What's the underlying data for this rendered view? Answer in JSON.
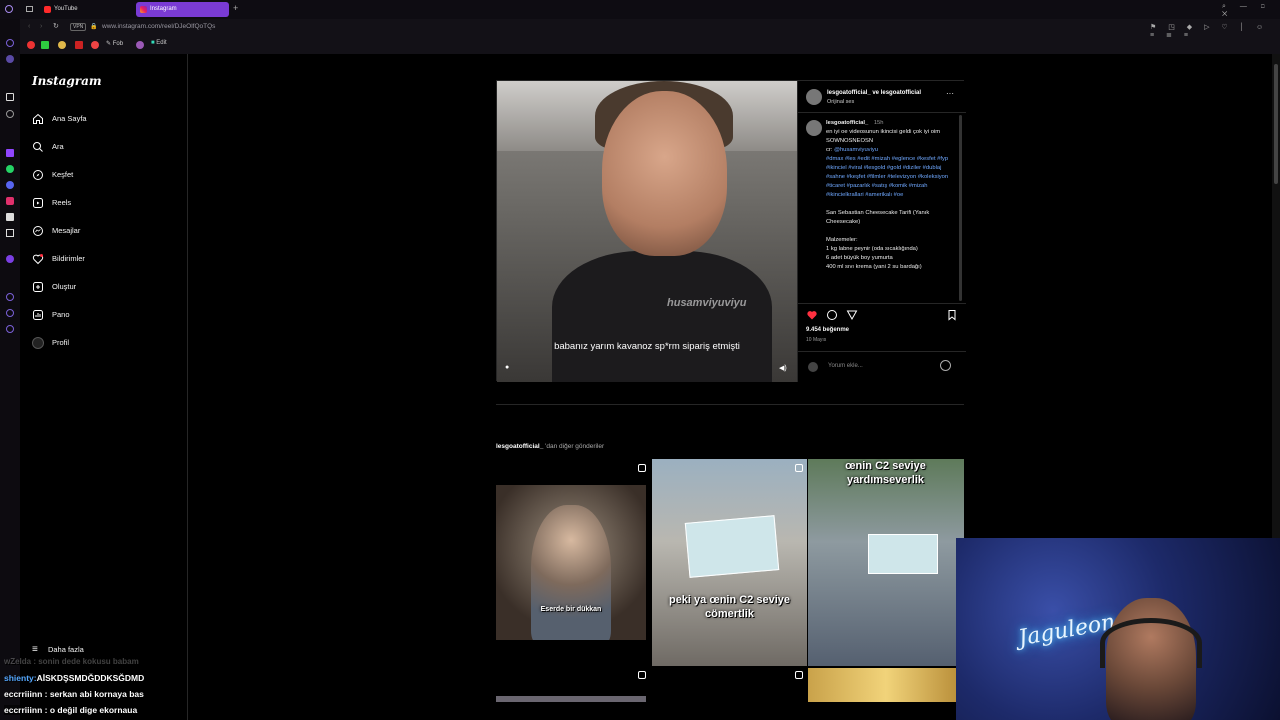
{
  "browser": {
    "tabs": [
      {
        "label": "YouTube"
      },
      {
        "label": "Instagram"
      }
    ],
    "url": "www.instagram.com/reel/DJeOlfQoTQs",
    "vpn_badge": "VPN",
    "bookmarks": [
      {
        "label": "Fob"
      },
      {
        "label": "Edit"
      }
    ]
  },
  "sidebar": {
    "logo": "Instagram",
    "items": [
      {
        "label": "Ana Sayfa",
        "icon": "home-icon"
      },
      {
        "label": "Ara",
        "icon": "search-icon"
      },
      {
        "label": "Keşfet",
        "icon": "compass-icon"
      },
      {
        "label": "Reels",
        "icon": "reels-icon"
      },
      {
        "label": "Mesajlar",
        "icon": "messenger-icon"
      },
      {
        "label": "Bildirimler",
        "icon": "heart-icon"
      },
      {
        "label": "Oluştur",
        "icon": "plus-square-icon"
      },
      {
        "label": "Pano",
        "icon": "dashboard-icon"
      },
      {
        "label": "Profil",
        "icon": "avatar-icon"
      }
    ],
    "more": "Daha fazla"
  },
  "post": {
    "video_watermark": "husamviyuviyu",
    "subtitle": "babanız yarım kavanoz sp*rm sipariş etmişti",
    "header_user": "lesgoatofficial_ ve lesgoatofficial",
    "header_sub": "Orijinal ses",
    "caption_user": "lesgoatofficial_",
    "caption_time": "15h",
    "caption_text": "en iyi oe videosunun ikincisi geldi çok iyi oim SOWNOSNEOSN",
    "caption_cr": "cr:",
    "caption_mention": "@husamviyuviyu",
    "caption_tags": "#dmax #les #edit #mizah #eglence #kesfet #fyp #ikinciel #viral #lesgold #gold #diziler #dublaj #sahne #keşfet #filmler #televizyon #koleksiyon #ticaret #pazarlık #satış #komik #mizah #ikincielkrallari #amerikalı #oe",
    "recipe_title": "San Sebastian Cheesecake Tarifi (Yanık Cheesecake)",
    "recipe_head": "Malzemeler:",
    "recipe_items": [
      "1 kg labne peynir (oda sıcaklığında)",
      "6 adet büyük boy yumurta",
      "400 ml sıvı krema (yani 2 su bardağı)"
    ],
    "likes": "9.454 beğenme",
    "date": "10 Mayıs",
    "comment_placeholder": "Yorum ekle..."
  },
  "more_posts": {
    "user": "lesgoatofficial_",
    "suffix": " 'dan diğer gönderiler",
    "items": [
      {
        "overlay": "Eserde bir dükkan"
      },
      {
        "overlay": "peki ya œnin C2 seviye cömertlik"
      },
      {
        "overlay": "œnin C2 seviye yardımseverlik"
      }
    ]
  },
  "webcam": {
    "neon": "Jaguleon"
  },
  "chat": [
    {
      "text": "wZelda : sonin dede kokusu babam"
    },
    {
      "user": "shienty:",
      "text": "AİSKDŞSMDĞDDKSĞDMD"
    },
    {
      "text": "eccrriiinn : serkan abi kornaya bas"
    },
    {
      "text": "eccrriiinn : o değil dige ekornaua"
    }
  ]
}
